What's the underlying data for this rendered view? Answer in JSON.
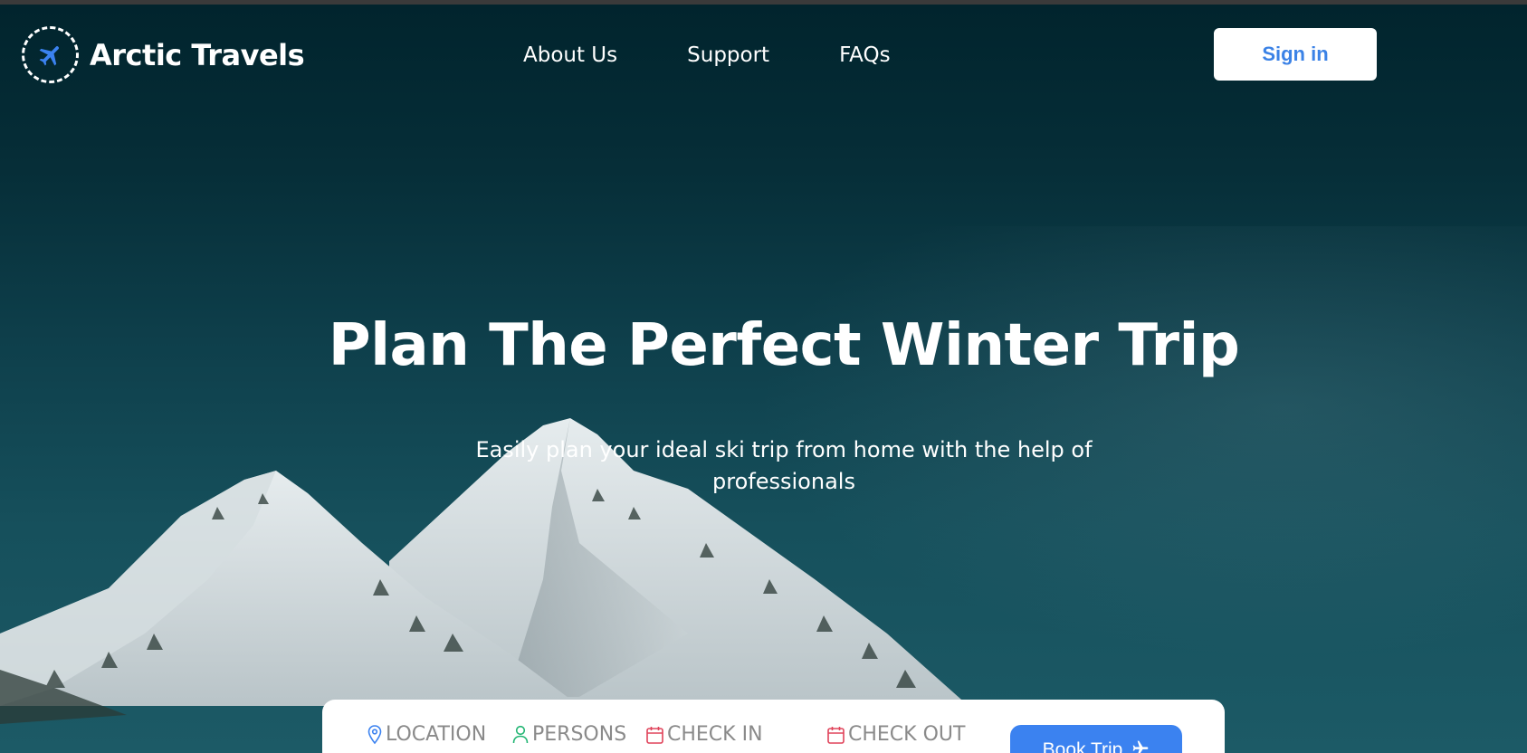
{
  "brand": {
    "name": "Arctic Travels",
    "logo_icon": "airplane-icon",
    "icon_color": "#3b82f0"
  },
  "nav": {
    "items": [
      "About Us",
      "Support",
      "FAQs"
    ]
  },
  "header": {
    "signin_label": "Sign in"
  },
  "hero": {
    "title": "Plan The Perfect Winter Trip",
    "subtitle": "Easily plan your ideal ski trip from home with the help of professionals"
  },
  "booking": {
    "fields": [
      {
        "label": "LOCATION",
        "icon": "location-pin-icon",
        "color": "#3b82f0"
      },
      {
        "label": "PERSONS",
        "icon": "person-icon",
        "color": "#22b573"
      },
      {
        "label": "CHECK IN",
        "icon": "calendar-icon",
        "color": "#e0435a"
      },
      {
        "label": "CHECK OUT",
        "icon": "calendar-icon",
        "color": "#e0435a"
      }
    ],
    "book_label": "Book Trip",
    "book_icon": "airplane-icon"
  },
  "colors": {
    "accent": "#3b82f0",
    "background": "#01232c"
  }
}
